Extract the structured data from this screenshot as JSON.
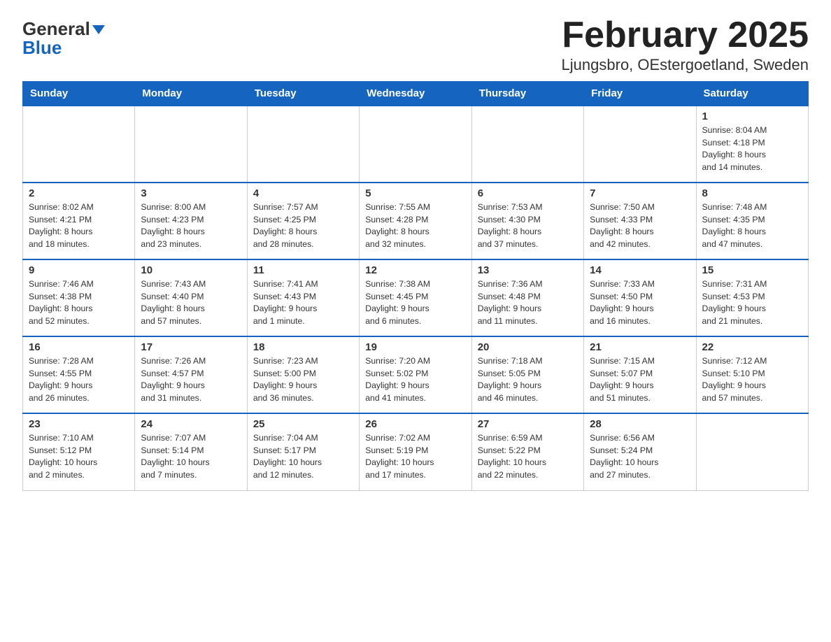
{
  "logo": {
    "general": "General",
    "blue": "Blue",
    "triangle": "▼"
  },
  "header": {
    "month_title": "February 2025",
    "location": "Ljungsbro, OEstergoetland, Sweden"
  },
  "weekdays": [
    "Sunday",
    "Monday",
    "Tuesday",
    "Wednesday",
    "Thursday",
    "Friday",
    "Saturday"
  ],
  "weeks": [
    [
      {
        "day": "",
        "info": ""
      },
      {
        "day": "",
        "info": ""
      },
      {
        "day": "",
        "info": ""
      },
      {
        "day": "",
        "info": ""
      },
      {
        "day": "",
        "info": ""
      },
      {
        "day": "",
        "info": ""
      },
      {
        "day": "1",
        "info": "Sunrise: 8:04 AM\nSunset: 4:18 PM\nDaylight: 8 hours\nand 14 minutes."
      }
    ],
    [
      {
        "day": "2",
        "info": "Sunrise: 8:02 AM\nSunset: 4:21 PM\nDaylight: 8 hours\nand 18 minutes."
      },
      {
        "day": "3",
        "info": "Sunrise: 8:00 AM\nSunset: 4:23 PM\nDaylight: 8 hours\nand 23 minutes."
      },
      {
        "day": "4",
        "info": "Sunrise: 7:57 AM\nSunset: 4:25 PM\nDaylight: 8 hours\nand 28 minutes."
      },
      {
        "day": "5",
        "info": "Sunrise: 7:55 AM\nSunset: 4:28 PM\nDaylight: 8 hours\nand 32 minutes."
      },
      {
        "day": "6",
        "info": "Sunrise: 7:53 AM\nSunset: 4:30 PM\nDaylight: 8 hours\nand 37 minutes."
      },
      {
        "day": "7",
        "info": "Sunrise: 7:50 AM\nSunset: 4:33 PM\nDaylight: 8 hours\nand 42 minutes."
      },
      {
        "day": "8",
        "info": "Sunrise: 7:48 AM\nSunset: 4:35 PM\nDaylight: 8 hours\nand 47 minutes."
      }
    ],
    [
      {
        "day": "9",
        "info": "Sunrise: 7:46 AM\nSunset: 4:38 PM\nDaylight: 8 hours\nand 52 minutes."
      },
      {
        "day": "10",
        "info": "Sunrise: 7:43 AM\nSunset: 4:40 PM\nDaylight: 8 hours\nand 57 minutes."
      },
      {
        "day": "11",
        "info": "Sunrise: 7:41 AM\nSunset: 4:43 PM\nDaylight: 9 hours\nand 1 minute."
      },
      {
        "day": "12",
        "info": "Sunrise: 7:38 AM\nSunset: 4:45 PM\nDaylight: 9 hours\nand 6 minutes."
      },
      {
        "day": "13",
        "info": "Sunrise: 7:36 AM\nSunset: 4:48 PM\nDaylight: 9 hours\nand 11 minutes."
      },
      {
        "day": "14",
        "info": "Sunrise: 7:33 AM\nSunset: 4:50 PM\nDaylight: 9 hours\nand 16 minutes."
      },
      {
        "day": "15",
        "info": "Sunrise: 7:31 AM\nSunset: 4:53 PM\nDaylight: 9 hours\nand 21 minutes."
      }
    ],
    [
      {
        "day": "16",
        "info": "Sunrise: 7:28 AM\nSunset: 4:55 PM\nDaylight: 9 hours\nand 26 minutes."
      },
      {
        "day": "17",
        "info": "Sunrise: 7:26 AM\nSunset: 4:57 PM\nDaylight: 9 hours\nand 31 minutes."
      },
      {
        "day": "18",
        "info": "Sunrise: 7:23 AM\nSunset: 5:00 PM\nDaylight: 9 hours\nand 36 minutes."
      },
      {
        "day": "19",
        "info": "Sunrise: 7:20 AM\nSunset: 5:02 PM\nDaylight: 9 hours\nand 41 minutes."
      },
      {
        "day": "20",
        "info": "Sunrise: 7:18 AM\nSunset: 5:05 PM\nDaylight: 9 hours\nand 46 minutes."
      },
      {
        "day": "21",
        "info": "Sunrise: 7:15 AM\nSunset: 5:07 PM\nDaylight: 9 hours\nand 51 minutes."
      },
      {
        "day": "22",
        "info": "Sunrise: 7:12 AM\nSunset: 5:10 PM\nDaylight: 9 hours\nand 57 minutes."
      }
    ],
    [
      {
        "day": "23",
        "info": "Sunrise: 7:10 AM\nSunset: 5:12 PM\nDaylight: 10 hours\nand 2 minutes."
      },
      {
        "day": "24",
        "info": "Sunrise: 7:07 AM\nSunset: 5:14 PM\nDaylight: 10 hours\nand 7 minutes."
      },
      {
        "day": "25",
        "info": "Sunrise: 7:04 AM\nSunset: 5:17 PM\nDaylight: 10 hours\nand 12 minutes."
      },
      {
        "day": "26",
        "info": "Sunrise: 7:02 AM\nSunset: 5:19 PM\nDaylight: 10 hours\nand 17 minutes."
      },
      {
        "day": "27",
        "info": "Sunrise: 6:59 AM\nSunset: 5:22 PM\nDaylight: 10 hours\nand 22 minutes."
      },
      {
        "day": "28",
        "info": "Sunrise: 6:56 AM\nSunset: 5:24 PM\nDaylight: 10 hours\nand 27 minutes."
      },
      {
        "day": "",
        "info": ""
      }
    ]
  ]
}
